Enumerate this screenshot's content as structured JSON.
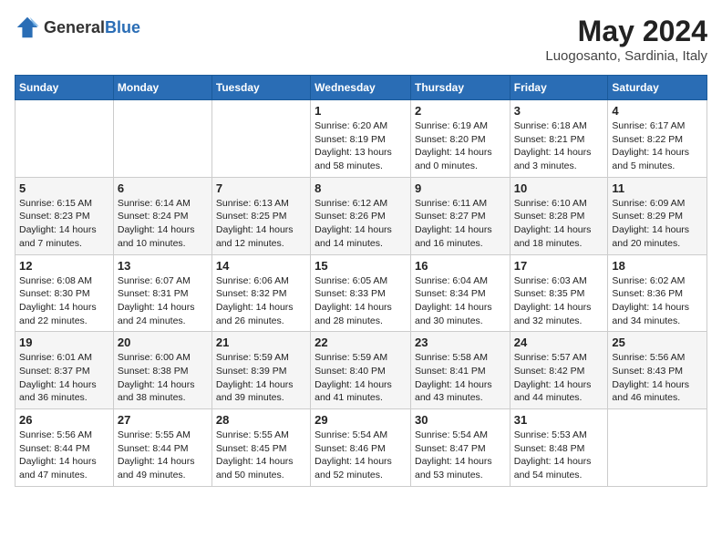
{
  "header": {
    "logo_general": "General",
    "logo_blue": "Blue",
    "month_year": "May 2024",
    "location": "Luogosanto, Sardinia, Italy"
  },
  "weekdays": [
    "Sunday",
    "Monday",
    "Tuesday",
    "Wednesday",
    "Thursday",
    "Friday",
    "Saturday"
  ],
  "weeks": [
    [
      {
        "day": "",
        "info": ""
      },
      {
        "day": "",
        "info": ""
      },
      {
        "day": "",
        "info": ""
      },
      {
        "day": "1",
        "sunrise": "Sunrise: 6:20 AM",
        "sunset": "Sunset: 8:19 PM",
        "daylight": "Daylight: 13 hours and 58 minutes."
      },
      {
        "day": "2",
        "sunrise": "Sunrise: 6:19 AM",
        "sunset": "Sunset: 8:20 PM",
        "daylight": "Daylight: 14 hours and 0 minutes."
      },
      {
        "day": "3",
        "sunrise": "Sunrise: 6:18 AM",
        "sunset": "Sunset: 8:21 PM",
        "daylight": "Daylight: 14 hours and 3 minutes."
      },
      {
        "day": "4",
        "sunrise": "Sunrise: 6:17 AM",
        "sunset": "Sunset: 8:22 PM",
        "daylight": "Daylight: 14 hours and 5 minutes."
      }
    ],
    [
      {
        "day": "5",
        "sunrise": "Sunrise: 6:15 AM",
        "sunset": "Sunset: 8:23 PM",
        "daylight": "Daylight: 14 hours and 7 minutes."
      },
      {
        "day": "6",
        "sunrise": "Sunrise: 6:14 AM",
        "sunset": "Sunset: 8:24 PM",
        "daylight": "Daylight: 14 hours and 10 minutes."
      },
      {
        "day": "7",
        "sunrise": "Sunrise: 6:13 AM",
        "sunset": "Sunset: 8:25 PM",
        "daylight": "Daylight: 14 hours and 12 minutes."
      },
      {
        "day": "8",
        "sunrise": "Sunrise: 6:12 AM",
        "sunset": "Sunset: 8:26 PM",
        "daylight": "Daylight: 14 hours and 14 minutes."
      },
      {
        "day": "9",
        "sunrise": "Sunrise: 6:11 AM",
        "sunset": "Sunset: 8:27 PM",
        "daylight": "Daylight: 14 hours and 16 minutes."
      },
      {
        "day": "10",
        "sunrise": "Sunrise: 6:10 AM",
        "sunset": "Sunset: 8:28 PM",
        "daylight": "Daylight: 14 hours and 18 minutes."
      },
      {
        "day": "11",
        "sunrise": "Sunrise: 6:09 AM",
        "sunset": "Sunset: 8:29 PM",
        "daylight": "Daylight: 14 hours and 20 minutes."
      }
    ],
    [
      {
        "day": "12",
        "sunrise": "Sunrise: 6:08 AM",
        "sunset": "Sunset: 8:30 PM",
        "daylight": "Daylight: 14 hours and 22 minutes."
      },
      {
        "day": "13",
        "sunrise": "Sunrise: 6:07 AM",
        "sunset": "Sunset: 8:31 PM",
        "daylight": "Daylight: 14 hours and 24 minutes."
      },
      {
        "day": "14",
        "sunrise": "Sunrise: 6:06 AM",
        "sunset": "Sunset: 8:32 PM",
        "daylight": "Daylight: 14 hours and 26 minutes."
      },
      {
        "day": "15",
        "sunrise": "Sunrise: 6:05 AM",
        "sunset": "Sunset: 8:33 PM",
        "daylight": "Daylight: 14 hours and 28 minutes."
      },
      {
        "day": "16",
        "sunrise": "Sunrise: 6:04 AM",
        "sunset": "Sunset: 8:34 PM",
        "daylight": "Daylight: 14 hours and 30 minutes."
      },
      {
        "day": "17",
        "sunrise": "Sunrise: 6:03 AM",
        "sunset": "Sunset: 8:35 PM",
        "daylight": "Daylight: 14 hours and 32 minutes."
      },
      {
        "day": "18",
        "sunrise": "Sunrise: 6:02 AM",
        "sunset": "Sunset: 8:36 PM",
        "daylight": "Daylight: 14 hours and 34 minutes."
      }
    ],
    [
      {
        "day": "19",
        "sunrise": "Sunrise: 6:01 AM",
        "sunset": "Sunset: 8:37 PM",
        "daylight": "Daylight: 14 hours and 36 minutes."
      },
      {
        "day": "20",
        "sunrise": "Sunrise: 6:00 AM",
        "sunset": "Sunset: 8:38 PM",
        "daylight": "Daylight: 14 hours and 38 minutes."
      },
      {
        "day": "21",
        "sunrise": "Sunrise: 5:59 AM",
        "sunset": "Sunset: 8:39 PM",
        "daylight": "Daylight: 14 hours and 39 minutes."
      },
      {
        "day": "22",
        "sunrise": "Sunrise: 5:59 AM",
        "sunset": "Sunset: 8:40 PM",
        "daylight": "Daylight: 14 hours and 41 minutes."
      },
      {
        "day": "23",
        "sunrise": "Sunrise: 5:58 AM",
        "sunset": "Sunset: 8:41 PM",
        "daylight": "Daylight: 14 hours and 43 minutes."
      },
      {
        "day": "24",
        "sunrise": "Sunrise: 5:57 AM",
        "sunset": "Sunset: 8:42 PM",
        "daylight": "Daylight: 14 hours and 44 minutes."
      },
      {
        "day": "25",
        "sunrise": "Sunrise: 5:56 AM",
        "sunset": "Sunset: 8:43 PM",
        "daylight": "Daylight: 14 hours and 46 minutes."
      }
    ],
    [
      {
        "day": "26",
        "sunrise": "Sunrise: 5:56 AM",
        "sunset": "Sunset: 8:44 PM",
        "daylight": "Daylight: 14 hours and 47 minutes."
      },
      {
        "day": "27",
        "sunrise": "Sunrise: 5:55 AM",
        "sunset": "Sunset: 8:44 PM",
        "daylight": "Daylight: 14 hours and 49 minutes."
      },
      {
        "day": "28",
        "sunrise": "Sunrise: 5:55 AM",
        "sunset": "Sunset: 8:45 PM",
        "daylight": "Daylight: 14 hours and 50 minutes."
      },
      {
        "day": "29",
        "sunrise": "Sunrise: 5:54 AM",
        "sunset": "Sunset: 8:46 PM",
        "daylight": "Daylight: 14 hours and 52 minutes."
      },
      {
        "day": "30",
        "sunrise": "Sunrise: 5:54 AM",
        "sunset": "Sunset: 8:47 PM",
        "daylight": "Daylight: 14 hours and 53 minutes."
      },
      {
        "day": "31",
        "sunrise": "Sunrise: 5:53 AM",
        "sunset": "Sunset: 8:48 PM",
        "daylight": "Daylight: 14 hours and 54 minutes."
      },
      {
        "day": "",
        "info": ""
      }
    ]
  ]
}
